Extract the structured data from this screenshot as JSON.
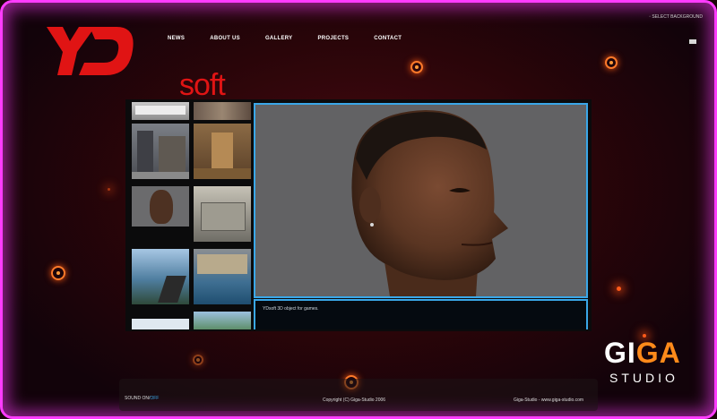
{
  "logo": {
    "mark": "YD",
    "suffix": "soft"
  },
  "nav": {
    "items": [
      "NEWS",
      "ABOUT US",
      "GALLERY",
      "PROJECTS",
      "CONTACT"
    ]
  },
  "top_right": {
    "background_selector": "SELECT BACKGROUND"
  },
  "gallery": {
    "thumbnails": [
      {
        "label": "bathroom-scene"
      },
      {
        "label": "tiled-interior"
      },
      {
        "label": "city-street"
      },
      {
        "label": "brick-corridor"
      },
      {
        "label": "head-portrait"
      },
      {
        "label": "industrial-platform"
      },
      {
        "label": "shooter-gun-view"
      },
      {
        "label": "water-courtyard"
      },
      {
        "label": "sky-scene"
      },
      {
        "label": "landscape-scene"
      }
    ],
    "caption": "YDsoft 3D object for games."
  },
  "footer": {
    "sound_label": "SOUND ON/",
    "sound_off": "OFF",
    "copyright": "Copyright (C) Giga-Studio 2006",
    "site": "Giga-Studio - www.giga-studio.com"
  },
  "watermark": {
    "giga_1": "GI",
    "giga_2": "GA",
    "studio": "STUDIO"
  },
  "colors": {
    "frame_border": "#ff3cff",
    "logo_red": "#e01414",
    "viewer_border": "#3aa7e8",
    "accent_orange": "#ff8a1a"
  }
}
